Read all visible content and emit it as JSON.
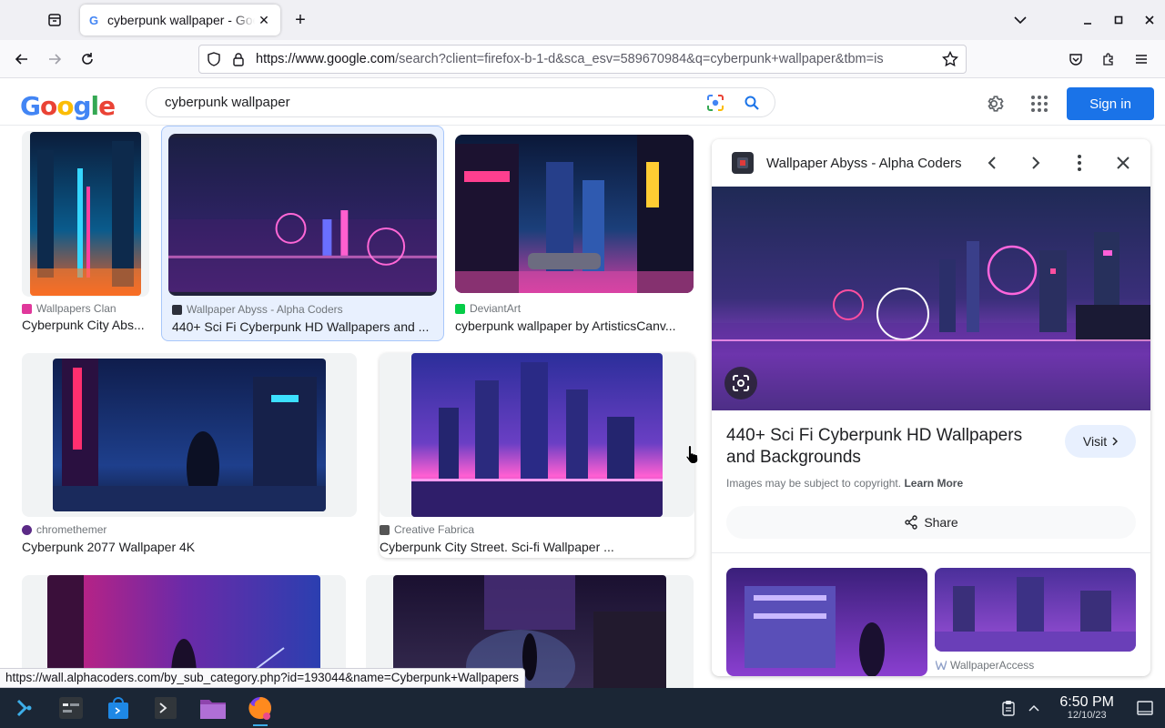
{
  "browser": {
    "tab_title": "cyberpunk wallpaper - Google Search",
    "url_host": "https://www.google.com",
    "url_path": "/search?client=firefox-b-1-d&sca_esv=589670984&q=cyberpunk+wallpaper&tbm=is",
    "status_link": "https://wall.alphacoders.com/by_sub_category.php?id=193044&name=Cyberpunk+Wallpapers"
  },
  "google": {
    "logo_letters": [
      "G",
      "o",
      "o",
      "g",
      "l",
      "e"
    ],
    "search_value": "cyberpunk wallpaper",
    "sign_in": "Sign in"
  },
  "results": [
    {
      "source": "Wallpapers Clan",
      "caption": "Cyberpunk City Abs...",
      "src_color": "#e0389b"
    },
    {
      "source": "Wallpaper Abyss - Alpha Coders",
      "caption": "440+ Sci Fi Cyberpunk HD Wallpapers and ...",
      "src_color": "#2c2f3a"
    },
    {
      "source": "DeviantArt",
      "caption": "cyberpunk wallpaper by ArtisticsCanv...",
      "src_color": "#05cc47"
    },
    {
      "source": "chromethemer",
      "caption": "Cyberpunk 2077 Wallpaper 4K",
      "src_color": "#5b2a86"
    },
    {
      "source": "Creative Fabrica",
      "caption": "Cyberpunk City Street. Sci-fi Wallpaper ...",
      "src_color": "#555555"
    }
  ],
  "panel": {
    "site_name": "Wallpaper Abyss - Alpha Coders",
    "title": "440+ Sci Fi Cyberpunk HD Wallpapers and Backgrounds",
    "visit": "Visit",
    "copyright": "Images may be subject to copyright.",
    "learn_more": "Learn More",
    "share": "Share",
    "related_source": "WallpaperAccess"
  },
  "taskbar": {
    "time": "6:50 PM",
    "date": "12/10/23"
  }
}
